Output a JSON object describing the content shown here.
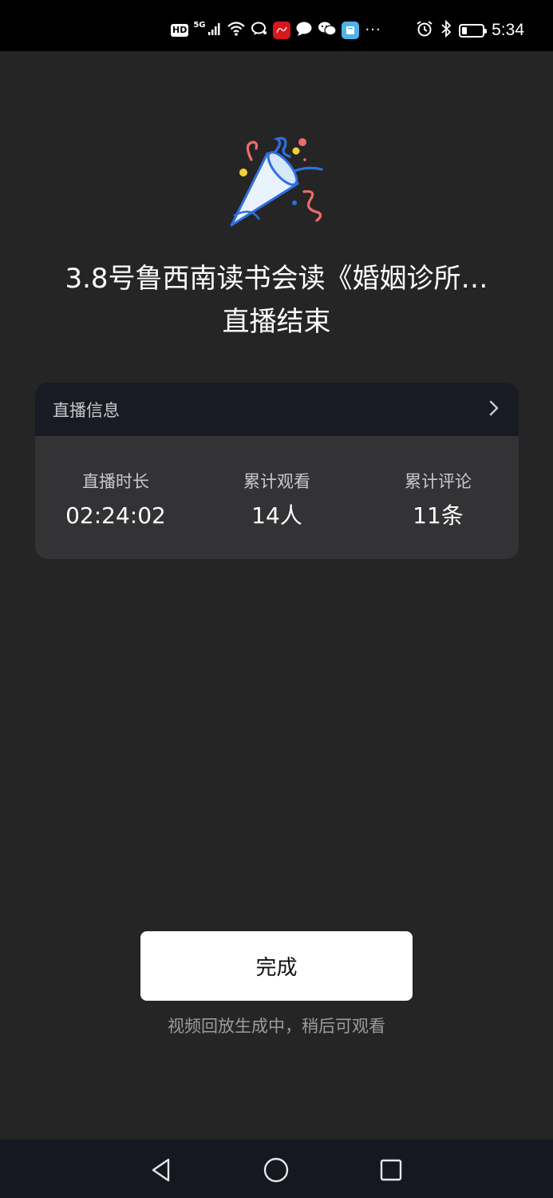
{
  "status_bar": {
    "hd_label": "HD",
    "network_label": "5G",
    "time": "5:34",
    "battery_level": 0.25,
    "left_icons": [
      "signal-icon",
      "wifi-icon",
      "chat-bubble-icon",
      "red-app-icon",
      "message-icon",
      "wechat-icon",
      "book-app-icon"
    ],
    "right_icons": [
      "alarm-icon",
      "bluetooth-icon",
      "battery-icon"
    ],
    "more_label": "···"
  },
  "main": {
    "title_line1": "3.8号鲁西南读书会读《婚姻诊所…",
    "title_line2": "直播结束"
  },
  "info_card": {
    "header_label": "直播信息",
    "stats": [
      {
        "label": "直播时长",
        "value": "02:24:02"
      },
      {
        "label": "累计观看",
        "value": "14人"
      },
      {
        "label": "累计评论",
        "value": "11条"
      }
    ]
  },
  "footer": {
    "done_label": "完成",
    "hint": "视频回放生成中，稍后可观看"
  },
  "colors": {
    "background": "#252525",
    "card": "#333335",
    "card_header": "#191b24",
    "nav_bar": "#151820",
    "confetti_blue": "#2f6fe0",
    "confetti_pink": "#f06b6b",
    "confetti_yellow": "#f5cf3b"
  }
}
